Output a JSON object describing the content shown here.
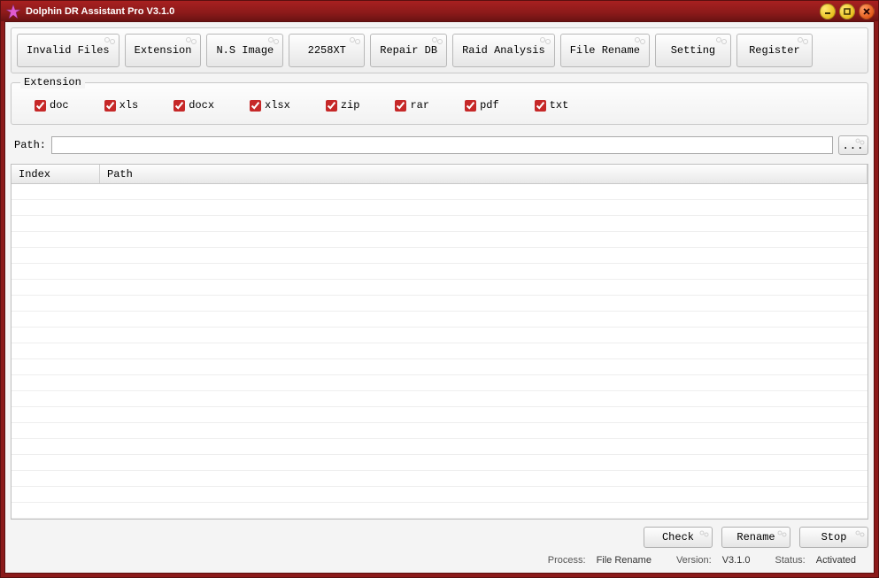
{
  "window": {
    "title": "Dolphin DR Assistant Pro V3.1.0"
  },
  "toolbar": [
    {
      "label": "Invalid Files"
    },
    {
      "label": "Extension"
    },
    {
      "label": "N.S Image"
    },
    {
      "label": "2258XT"
    },
    {
      "label": "Repair DB"
    },
    {
      "label": "Raid Analysis"
    },
    {
      "label": "File Rename"
    },
    {
      "label": "Setting"
    },
    {
      "label": "Register"
    }
  ],
  "extension_group": {
    "legend": "Extension",
    "items": [
      {
        "label": "doc",
        "checked": true
      },
      {
        "label": "xls",
        "checked": true
      },
      {
        "label": "docx",
        "checked": true
      },
      {
        "label": "xlsx",
        "checked": true
      },
      {
        "label": "zip",
        "checked": true
      },
      {
        "label": "rar",
        "checked": true
      },
      {
        "label": "pdf",
        "checked": true
      },
      {
        "label": "txt",
        "checked": true
      }
    ]
  },
  "path": {
    "label": "Path:",
    "value": "",
    "browse": "..."
  },
  "table": {
    "columns": {
      "index": "Index",
      "path": "Path"
    },
    "rows": []
  },
  "actions": {
    "check": "Check",
    "rename": "Rename",
    "stop": "Stop"
  },
  "status": {
    "process_label": "Process:",
    "process_value": "File Rename",
    "version_label": "Version:",
    "version_value": "V3.1.0",
    "status_label": "Status:",
    "status_value": "Activated"
  }
}
